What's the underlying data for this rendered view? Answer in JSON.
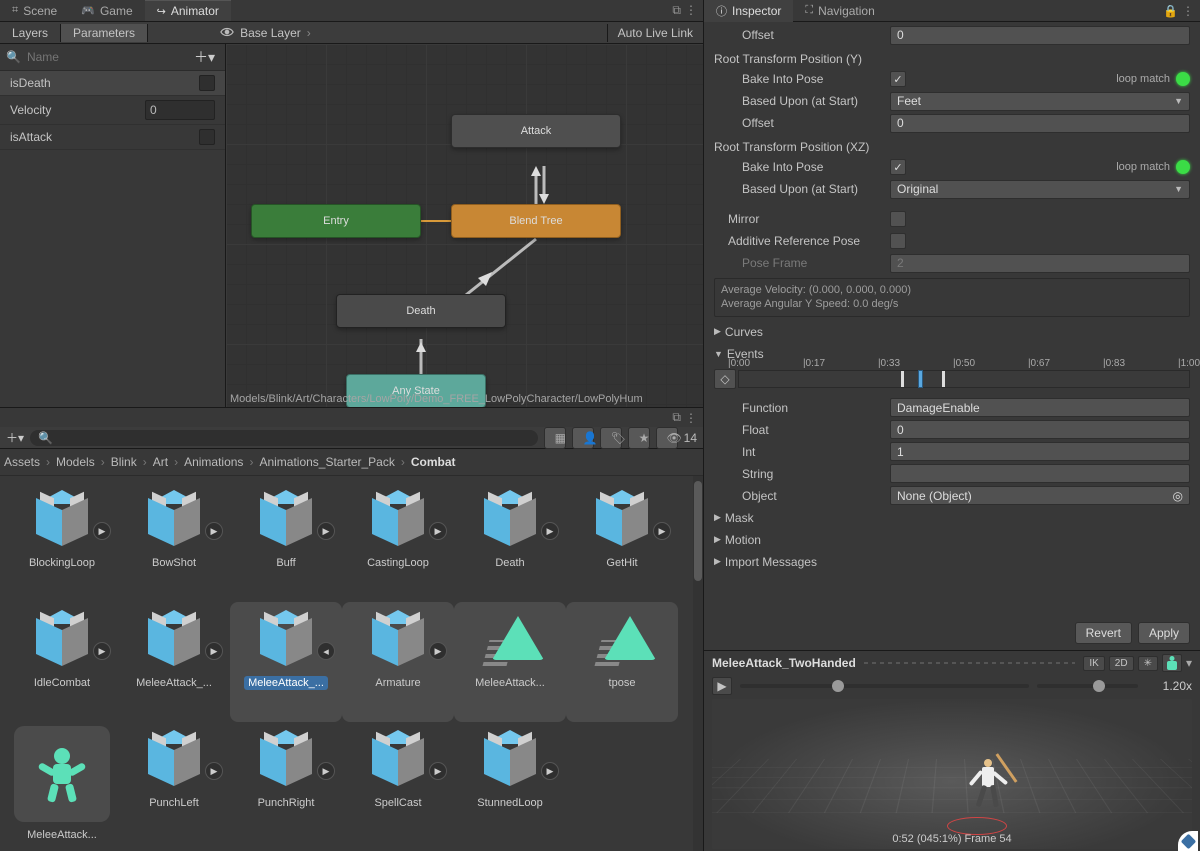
{
  "tabs": {
    "scene": "Scene",
    "game": "Game",
    "animator": "Animator"
  },
  "animator": {
    "layers_tab": "Layers",
    "params_tab": "Parameters",
    "base_layer": "Base Layer",
    "auto_live": "Auto Live Link",
    "search_placeholder": "Name",
    "params": [
      {
        "name": "isDeath",
        "type": "bool",
        "value": false
      },
      {
        "name": "Velocity",
        "type": "float",
        "value": "0"
      },
      {
        "name": "isAttack",
        "type": "bool",
        "value": false
      }
    ],
    "nodes": {
      "entry": "Entry",
      "blend": "Blend Tree",
      "attack": "Attack",
      "death": "Death",
      "any": "Any State"
    },
    "path": "Models/Blink/Art/Characters/LowPoly/Demo_FREE_LowPolyCharacter/LowPolyHum"
  },
  "project": {
    "hidden_count": "14",
    "crumbs": [
      "Assets",
      "Models",
      "Blink",
      "Art",
      "Animations",
      "Animations_Starter_Pack",
      "Combat"
    ],
    "assets": [
      {
        "name": "BlockingLoop",
        "kind": "box",
        "play": true
      },
      {
        "name": "BowShot",
        "kind": "box",
        "play": true
      },
      {
        "name": "Buff",
        "kind": "box",
        "play": true
      },
      {
        "name": "CastingLoop",
        "kind": "box",
        "play": true
      },
      {
        "name": "Death",
        "kind": "box",
        "play": true
      },
      {
        "name": "GetHit",
        "kind": "box",
        "play": true
      },
      {
        "name": "IdleCombat",
        "kind": "box",
        "play": true
      },
      {
        "name": "MeleeAttack_...",
        "kind": "box",
        "play": true
      },
      {
        "name": "MeleeAttack_...",
        "kind": "box",
        "play": false,
        "expand": true,
        "sel": true,
        "group": true
      },
      {
        "name": "Armature",
        "kind": "box",
        "play": true,
        "group": true
      },
      {
        "name": "MeleeAttack...",
        "kind": "tri",
        "group": true
      },
      {
        "name": "tpose",
        "kind": "tri",
        "group": true
      },
      {
        "name": "MeleeAttack...",
        "kind": "clip",
        "clip": true
      },
      {
        "name": "PunchLeft",
        "kind": "box",
        "play": true
      },
      {
        "name": "PunchRight",
        "kind": "box",
        "play": true
      },
      {
        "name": "SpellCast",
        "kind": "box",
        "play": true
      },
      {
        "name": "StunnedLoop",
        "kind": "box",
        "play": true
      }
    ]
  },
  "inspector": {
    "tab": "Inspector",
    "nav_tab": "Navigation",
    "offset1": {
      "label": "Offset",
      "value": "0"
    },
    "rty": {
      "title": "Root Transform Position (Y)",
      "bake": "Bake Into Pose",
      "bake_v": true,
      "loop": "loop match",
      "based": "Based Upon (at Start)",
      "based_v": "Feet",
      "offset": "Offset",
      "offset_v": "0"
    },
    "rtxz": {
      "title": "Root Transform Position (XZ)",
      "bake": "Bake Into Pose",
      "bake_v": true,
      "loop": "loop match",
      "based": "Based Upon (at Start)",
      "based_v": "Original"
    },
    "mirror": {
      "label": "Mirror",
      "value": false
    },
    "additive": {
      "label": "Additive Reference Pose",
      "value": false
    },
    "poseframe": {
      "label": "Pose Frame",
      "value": "2"
    },
    "avg": {
      "l1": "Average Velocity: (0.000, 0.000, 0.000)",
      "l2": "Average Angular Y Speed: 0.0 deg/s"
    },
    "curves": "Curves",
    "events": "Events",
    "timeline": {
      "ticks": [
        "0:00",
        "0:17",
        "0:33",
        "0:50",
        "0:67",
        "0:83",
        "1:00"
      ],
      "markers": [
        0.36,
        0.4,
        0.45
      ],
      "selected": 1
    },
    "fn": {
      "label": "Function",
      "value": "DamageEnable"
    },
    "float": {
      "label": "Float",
      "value": "0"
    },
    "int": {
      "label": "Int",
      "value": "1"
    },
    "string": {
      "label": "String",
      "value": ""
    },
    "object": {
      "label": "Object",
      "value": "None (Object)"
    },
    "mask": "Mask",
    "motion": "Motion",
    "import": "Import Messages",
    "revert": "Revert",
    "apply": "Apply"
  },
  "preview": {
    "title": "MeleeAttack_TwoHanded",
    "ik": "IK",
    "two_d": "2D",
    "speed": "1.20x",
    "frame": "0:52 (045:1%) Frame 54"
  }
}
